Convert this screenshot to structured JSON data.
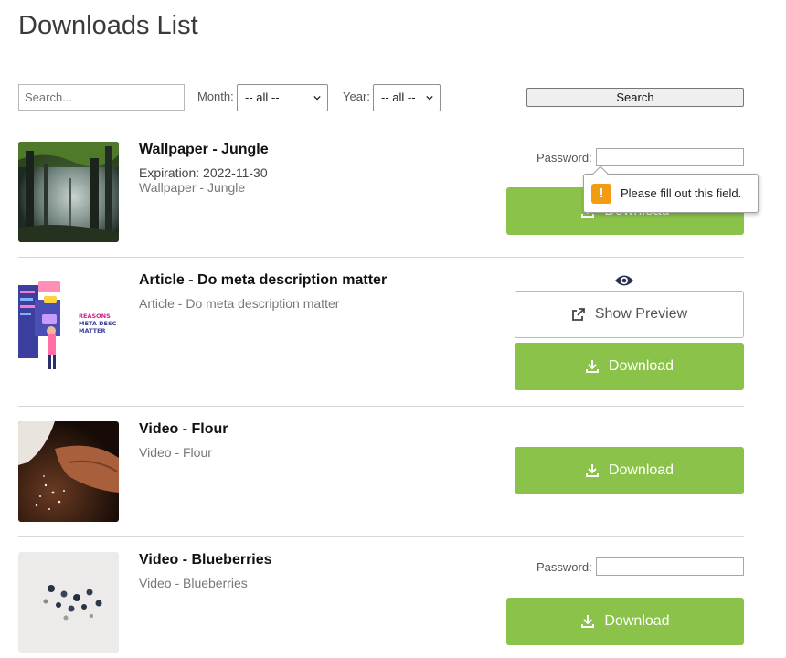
{
  "page": {
    "title": "Downloads List"
  },
  "filters": {
    "search_placeholder": "Search...",
    "month_label": "Month:",
    "month_value": "-- all --",
    "year_label": "Year:",
    "year_value": "-- all --",
    "search_button": "Search"
  },
  "password_label": "Password:",
  "download_label": "Download",
  "items": [
    {
      "title": "Wallpaper - Jungle",
      "expiration": "Expiration: 2022-11-30",
      "description": "Wallpaper - Jungle",
      "validation_message": "Please fill out this field.",
      "warning_glyph": "!"
    },
    {
      "title": "Article - Do meta description matter",
      "description": "Article - Do meta description matter",
      "preview_label": "Show Preview",
      "thumb_text": [
        "REASONS",
        "META DESC",
        "MATTER"
      ]
    },
    {
      "title": "Video - Flour",
      "description": "Video - Flour"
    },
    {
      "title": "Video - Blueberries",
      "description": "Video - Blueberries"
    }
  ],
  "colors": {
    "download_green": "#8bc34a",
    "warning_orange": "#f39c12",
    "eye_navy": "#2c3154"
  }
}
